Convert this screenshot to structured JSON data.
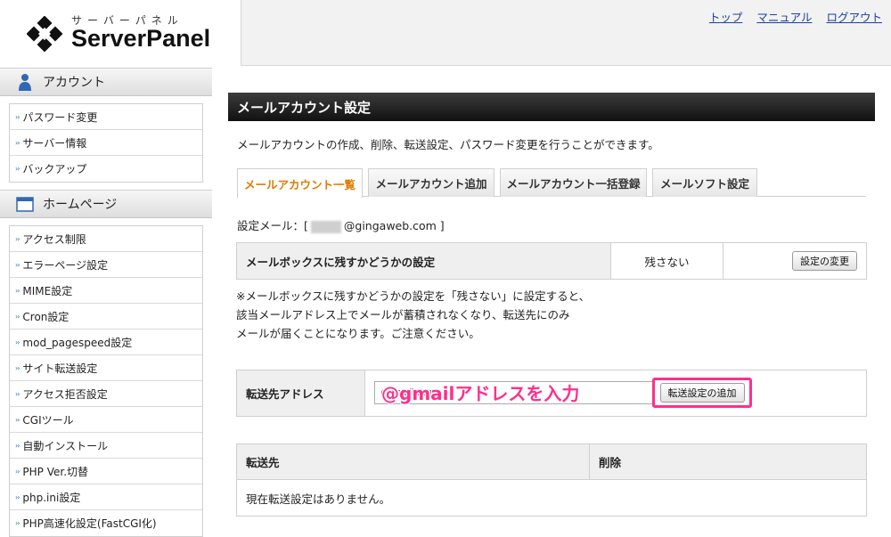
{
  "logo": {
    "kana": "サーバーパネル",
    "name": "ServerPanel"
  },
  "toplinks": [
    "トップ",
    "マニュアル",
    "ログアウト"
  ],
  "sidebar": {
    "account": {
      "title": "アカウント",
      "items": [
        "パスワード変更",
        "サーバー情報",
        "バックアップ"
      ]
    },
    "homepage": {
      "title": "ホームページ",
      "items": [
        "アクセス制限",
        "エラーページ設定",
        "MIME設定",
        "Cron設定",
        "mod_pagespeed設定",
        "サイト転送設定",
        "アクセス拒否設定",
        "CGIツール",
        "自動インストール",
        "PHP Ver.切替",
        "php.ini設定",
        "PHP高速化設定(FastCGI化)"
      ]
    }
  },
  "main": {
    "title": "メールアカウント設定",
    "description": "メールアカウントの作成、削除、転送設定、パスワード変更を行うことができます。",
    "tabs": [
      "メールアカウント一覧",
      "メールアカウント追加",
      "メールアカウント一括登録",
      "メールソフト設定"
    ],
    "setting_mail_prefix": "設定メール：[",
    "setting_mail_domain": "@gingaweb.com ]",
    "mailbox": {
      "label": "メールボックスに残すかどうかの設定",
      "value": "残さない",
      "button": "設定の変更"
    },
    "notice": [
      "※メールボックスに残すかどうかの設定を「残さない」に設定すると、",
      "該当メールアドレス上でメールが蓄積されなくなり、転送先にのみ",
      "メールが届くことになります。ご注意ください。"
    ],
    "forward": {
      "label": "転送先アドレス",
      "input_value": "@gmail.com",
      "annotation": "@gmailアドレスを入力",
      "button": "転送設定の追加"
    },
    "destinations": {
      "col_dest": "転送先",
      "col_delete": "削除",
      "empty": "現在転送設定はありません。"
    }
  }
}
